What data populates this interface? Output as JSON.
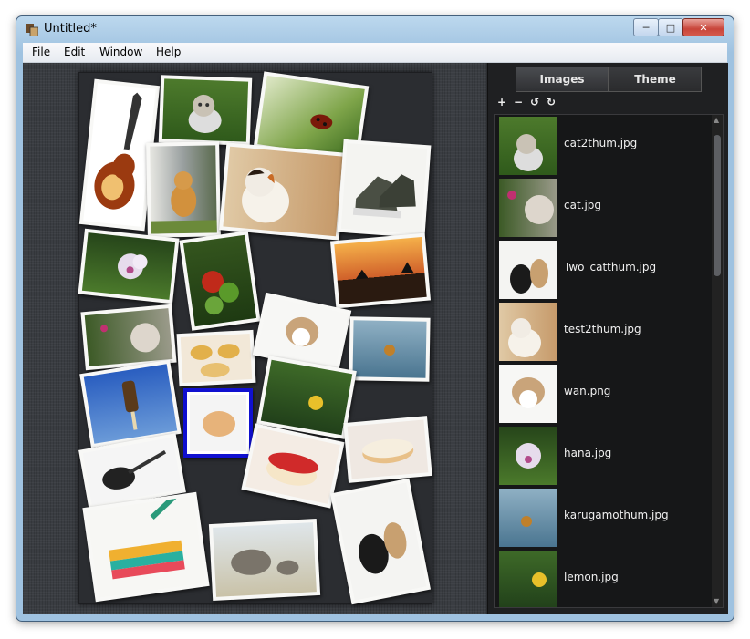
{
  "window": {
    "title": "Untitled*",
    "minimize_glyph": "─",
    "maximize_glyph": "□",
    "close_glyph": "✕"
  },
  "menu": [
    "File",
    "Edit",
    "Window",
    "Help"
  ],
  "tabs": [
    {
      "label": "Images",
      "active": true
    },
    {
      "label": "Theme",
      "active": false
    }
  ],
  "toolbar": {
    "add": "+",
    "remove": "−",
    "rotate_left": "↺",
    "rotate_right": "↻"
  },
  "files": [
    "cat2thum.jpg",
    "cat.jpg",
    "Two_catthum.jpg",
    "test2thum.jpg",
    "wan.png",
    "hana.jpg",
    "karugamothum.jpg",
    "lemon.jpg"
  ],
  "colors": {
    "canvas": "#3a3d42",
    "panel": "#1f2022",
    "selection": "#1010d0"
  }
}
